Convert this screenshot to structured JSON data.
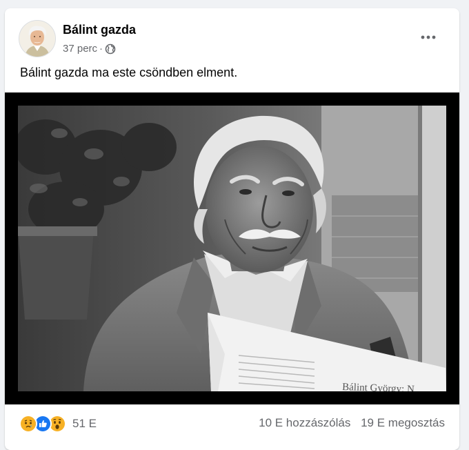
{
  "post": {
    "author": "Bálint gazda",
    "time": "37 perc",
    "separator": "·",
    "audience_icon": "globe-icon",
    "more_icon": "more-horizontal-icon",
    "text": "Bálint gazda ma este csöndben elment.",
    "photo": {
      "alt": "Bálint gazda",
      "newspaper_text": "Bálint György: N"
    }
  },
  "footer": {
    "reaction_icons": [
      "sad-reaction-icon",
      "like-reaction-icon",
      "wow-reaction-icon"
    ],
    "reactions_count": "51 E",
    "comments": "10 E hozzászólás",
    "shares": "19 E megosztás"
  },
  "colors": {
    "background": "#f0f2f5",
    "card": "#ffffff",
    "secondary_text": "#65676b",
    "like_blue": "#1877f2",
    "emoji_yellow": "#f7b125"
  }
}
